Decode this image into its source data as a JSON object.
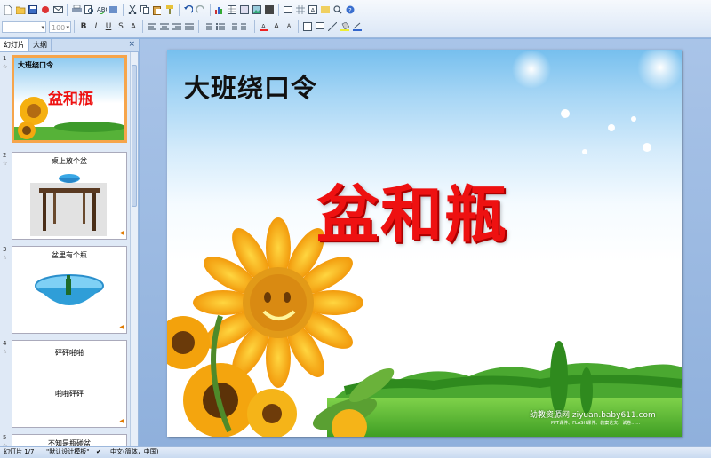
{
  "toolbar": {
    "font_name": "",
    "font_size": "100"
  },
  "panel": {
    "tabs": [
      "幻灯片",
      "大纲"
    ],
    "close_label": "×"
  },
  "thumbnails": [
    {
      "number": "1",
      "title": "大班绕口令",
      "subtitle": "盆和瓶"
    },
    {
      "number": "2",
      "title": "桌上放个盆"
    },
    {
      "number": "3",
      "title": "盆里有个瓶"
    },
    {
      "number": "4",
      "title": "砰砰啪啪",
      "line2": "啪啪砰砰"
    },
    {
      "number": "5",
      "title": "不知是瓶碰盆"
    }
  ],
  "slide": {
    "heading": "大班绕口令",
    "title": "盆和瓶",
    "watermark": "幼教资源网 ziyuan.baby611.com",
    "watermark_sub": "PPT课件、FLASH课件、教案论文、试卷……"
  },
  "status": {
    "slide_counter": "幻灯片 1/7",
    "template": "\"默认设计模板\"",
    "language": "中文(简体，中国)"
  },
  "colors": {
    "title_red": "#ee1111",
    "selection_orange": "#f6a54b",
    "ui_blue": "#9db8dc"
  }
}
